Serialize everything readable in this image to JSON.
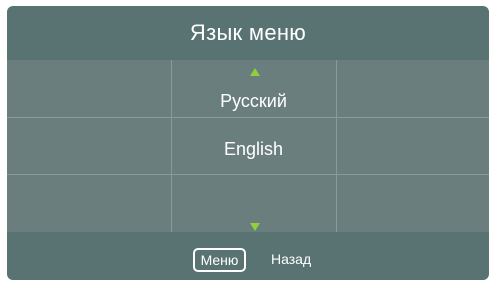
{
  "dialog": {
    "title": "Язык меню"
  },
  "languages": {
    "options": [
      {
        "label": "Русский"
      },
      {
        "label": "English"
      }
    ]
  },
  "footer": {
    "menu_label": "Меню",
    "back_label": "Назад"
  },
  "colors": {
    "panel_bg": "#587372",
    "list_bg": "#6a7e7d",
    "grid_line": "#889b9a",
    "arrow": "#8fd03f",
    "text": "#ffffff"
  },
  "icons": {
    "scroll_up": "triangle-up-icon",
    "scroll_down": "triangle-down-icon"
  }
}
